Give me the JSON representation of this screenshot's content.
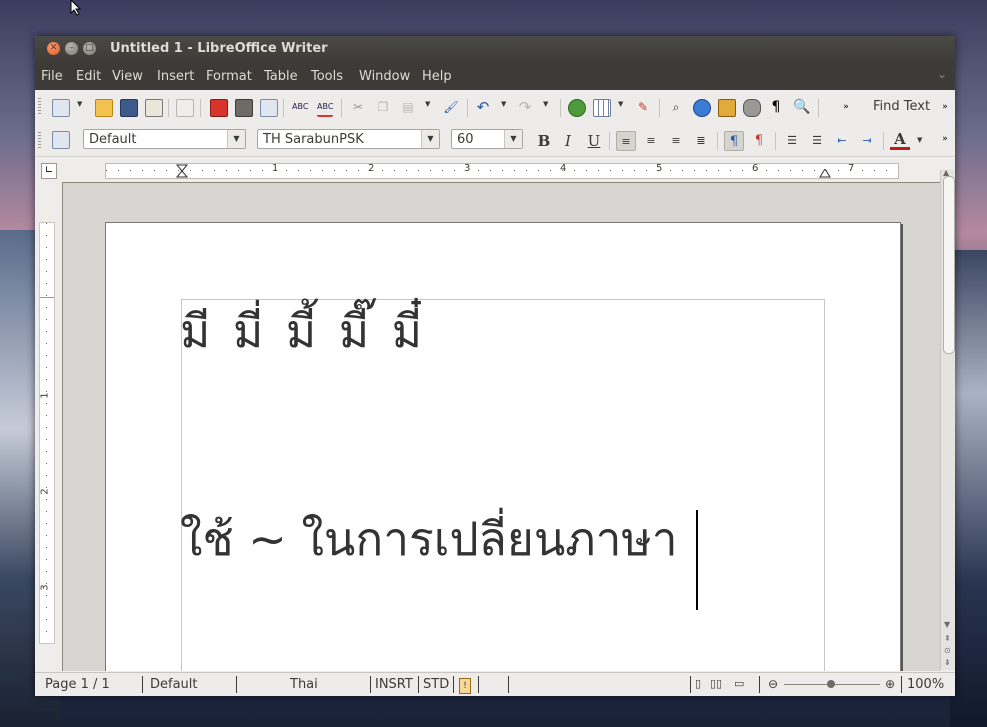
{
  "window": {
    "title": "Untitled 1 - LibreOffice Writer"
  },
  "menu": [
    "File",
    "Edit",
    "View",
    "Insert",
    "Format",
    "Table",
    "Tools",
    "Window",
    "Help"
  ],
  "toolbar": {
    "find_text": "Find Text"
  },
  "format_bar": {
    "paragraph_style": "Default",
    "font_name": "TH SarabunPSK",
    "font_size": "60",
    "bold_label": "B",
    "italic_label": "I",
    "underline_label": "U",
    "font_color_label": "A"
  },
  "ruler": {
    "h_numbers": [
      "1",
      "2",
      "3",
      "4",
      "5",
      "6",
      "7"
    ],
    "v_numbers": [
      "1",
      "2",
      "3"
    ]
  },
  "document": {
    "line1": "มี มี่ มี้ มี๊ มี๋",
    "line2": "ใช้ ~ ในการเปลี่ยนภาษา"
  },
  "statusbar": {
    "page": "Page 1 / 1",
    "style": "Default",
    "language": "Thai",
    "insert_mode": "INSRT",
    "selection_mode": "STD",
    "zoom": "100%"
  },
  "colors": {
    "titlebar": "#3c3b37",
    "close_button": "#e0531b",
    "font_color_swatch": "#c0191b"
  },
  "icons": [
    "new-icon",
    "open-icon",
    "save-icon",
    "email-icon",
    "edit-mode-icon",
    "pdf-icon",
    "print-icon",
    "print-preview-icon",
    "spellcheck-icon",
    "autospell-icon",
    "cut-icon",
    "copy-icon",
    "paste-icon",
    "clone-format-icon",
    "undo-icon",
    "redo-icon",
    "hyperlink-icon",
    "table-icon",
    "draw-icon",
    "find-replace-icon",
    "navigator-icon",
    "gallery-icon",
    "data-sources-icon",
    "formatting-marks-icon",
    "zoom-icon"
  ]
}
